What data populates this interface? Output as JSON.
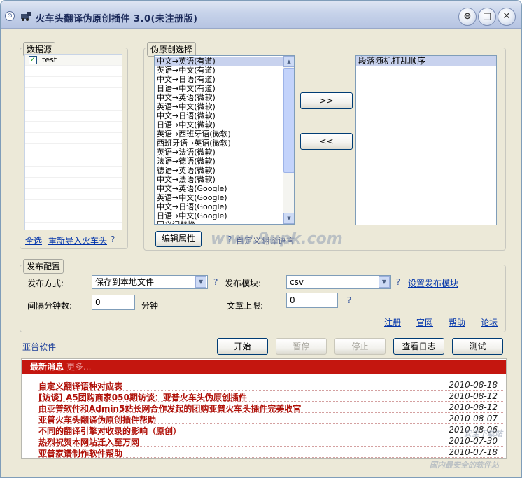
{
  "window": {
    "title": "火车头翻译伪原创插件 3.0(未注册版)",
    "controls": {
      "menu": "⊙",
      "minimize": "⊖",
      "maximize": "□",
      "close": "✕"
    }
  },
  "datasource": {
    "legend": "数据源",
    "items": [
      {
        "label": "test",
        "checked": true
      }
    ],
    "select_all": "全选",
    "reimport": "重新导入火车头",
    "help": "?"
  },
  "pseudo": {
    "legend": "伪原创选择",
    "options": [
      "中文→英语(有道)",
      "英语→中文(有道)",
      "中文→日语(有道)",
      "日语→中文(有道)",
      "中文→英语(微软)",
      "英语→中文(微软)",
      "中文→日语(微软)",
      "日语→中文(微软)",
      "英语→西班牙语(微软)",
      "西班牙语→英语(微软)",
      "英语→法语(微软)",
      "法语→德语(微软)",
      "德语→英语(微软)",
      "中文→法语(微软)",
      "中文→英语(Google)",
      "英语→中文(Google)",
      "中文→日语(Google)",
      "日语→中文(Google)",
      "同义词替换"
    ],
    "selected": [
      "段落随机打乱顺序"
    ],
    "add_button": ">>",
    "remove_button": "<<",
    "edit_button": "编辑属性",
    "custom_help": "?",
    "custom_label": "自定义翻译语言"
  },
  "publish": {
    "legend": "发布配置",
    "method_label": "发布方式:",
    "method_value": "保存到本地文件",
    "method_help": "?",
    "module_label": "发布模块:",
    "module_value": "csv",
    "module_help": "?",
    "module_link": "设置发布模块",
    "interval_label": "间隔分钟数:",
    "interval_value": "0",
    "interval_unit": "分钟",
    "limit_label": "文章上限:",
    "limit_value": "0",
    "limit_help": "?",
    "links": [
      "注册",
      "官网",
      "帮助",
      "论坛"
    ]
  },
  "actions": {
    "brand": "亚普软件",
    "start": "开始",
    "pause": "暂停",
    "stop": "停止",
    "log": "查看日志",
    "test": "测试"
  },
  "news": {
    "header": "最新消息",
    "header_faded": "更多...",
    "items": [
      {
        "title": "自定义翻译语种对应表",
        "date": "2010-08-18"
      },
      {
        "title": "[访谈] A5团购商家050期访谈：亚普火车头伪原创插件",
        "date": "2010-08-12"
      },
      {
        "title": "由亚普软件和Admin5站长网合作发起的团购亚普火车头插件完美收官",
        "date": "2010-08-12"
      },
      {
        "title": "亚普火车头翻译伪原创插件帮助",
        "date": "2010-08-07"
      },
      {
        "title": "不同的翻译引擎对收录的影响（原创）",
        "date": "2010-08-06"
      },
      {
        "title": "热烈祝贺本网站迁入至万网",
        "date": "2010-07-30"
      },
      {
        "title": "亚普家谱制作软件帮助",
        "date": "2010-07-18"
      }
    ]
  },
  "watermarks": {
    "center": "www.9upk.com",
    "corner_top": "安全下载站",
    "corner_bottom": "国内最安全的软件站"
  }
}
